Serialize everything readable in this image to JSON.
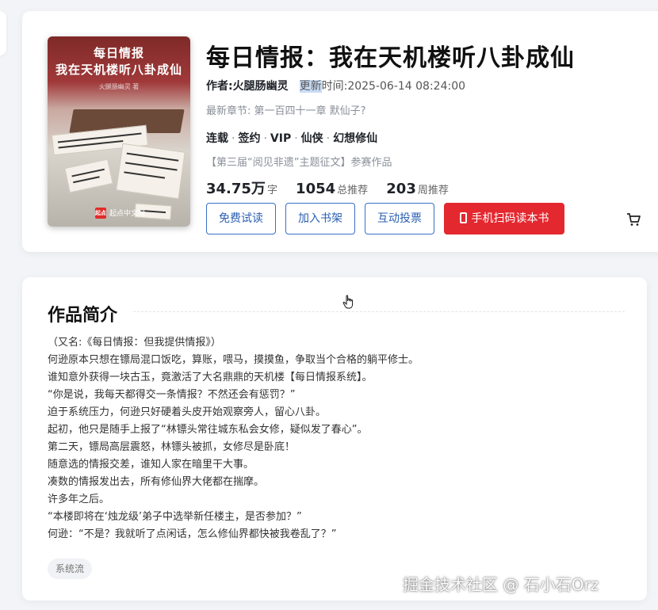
{
  "book": {
    "title": "每日情报：我在天机楼听八卦成仙",
    "author": "作者:火腿肠幽灵",
    "update_highlight": "更新",
    "update_rest": "时间:2025-06-14 08:24:00",
    "latest_chapter": "最新章节: 第一百四十一章 默仙子?",
    "tags": [
      "连载",
      "签约",
      "VIP",
      "仙侠",
      "幻想修仙"
    ],
    "contest": "【第三届“阅见非遗”主题征文】参赛作品",
    "stats": [
      {
        "value": "34.75万",
        "unit": "字"
      },
      {
        "value": "1054",
        "unit": "总推荐"
      },
      {
        "value": "203",
        "unit": "周推荐"
      }
    ]
  },
  "cover": {
    "title_line1": "每日情报",
    "title_line2": "我在天机楼听八卦成仙",
    "author": "火腿肠幽灵 著",
    "logo": "起点",
    "publisher": "起点中文网"
  },
  "actions": {
    "free_trial": "免费试读",
    "add_shelf": "加入书架",
    "vote": "互动投票",
    "scan_read": "手机扫码读本书",
    "cart_icon": "cart-icon"
  },
  "intro": {
    "heading": "作品简介",
    "lines": [
      "（又名:《每日情报：但我提供情报》）",
      "何逊原本只想在镖局混口饭吃，算账，喂马，摸摸鱼，争取当个合格的躺平修士。",
      "谁知意外获得一块古玉，竟激活了大名鼎鼎的天机楼【每日情报系统】。",
      "“你是说，我每天都得交一条情报？不然还会有惩罚？”",
      "迫于系统压力，何逊只好硬着头皮开始观察旁人，留心八卦。",
      "起初，他只是随手上报了“林镖头常往城东私会女修，疑似发了春心”。",
      "第二天，镖局高层震怒，林镖头被抓，女修尽是卧底！",
      "随意选的情报交差，谁知人家在暗里干大事。",
      "凑数的情报发出去，所有修仙界大佬都在揣摩。",
      "许多年之后。",
      "“本楼即将在‘烛龙级’弟子中选举新任楼主，是否参加？”",
      "何逊：“不是？我就听了点闲话，怎么修仙界都快被我卷乱了？”"
    ],
    "tag": "系统流"
  },
  "watermark": "掘金技术社区 @ 石小石Orz",
  "colors": {
    "accent_blue": "#3a6fc4",
    "primary_red": "#e4282f",
    "highlight": "#c9dcf6"
  }
}
